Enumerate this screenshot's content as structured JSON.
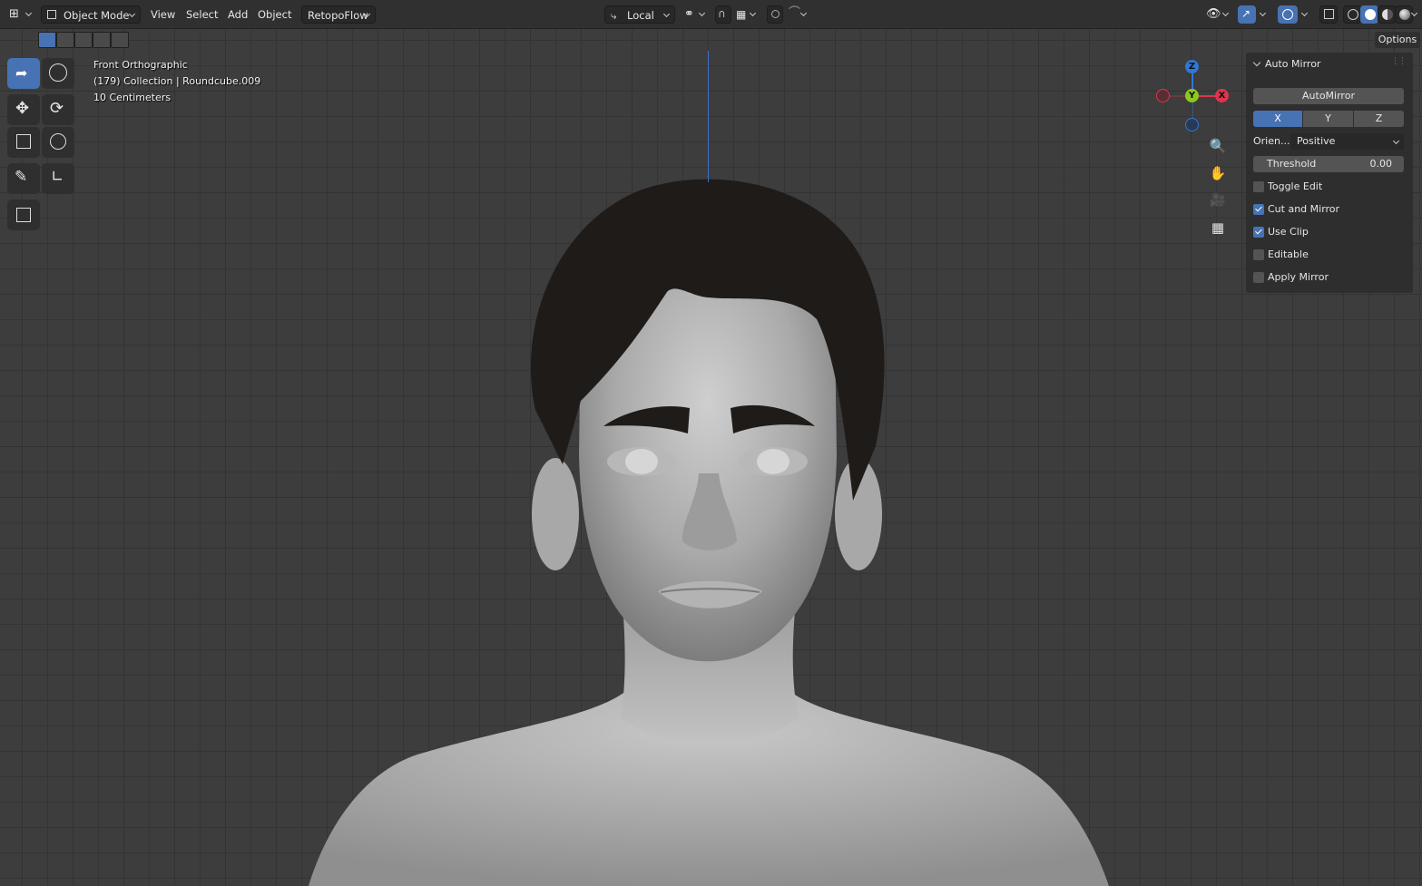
{
  "header": {
    "editor_type_icon": "editor-type-icon",
    "mode_label": "Object Mode",
    "menus": [
      "View",
      "Select",
      "Add",
      "Object"
    ],
    "addon_menu": "RetopoFlow",
    "transform_orientation": "Local"
  },
  "viewport": {
    "view_name": "Front Orthographic",
    "collection_info": "(179) Collection | Roundcube.009",
    "grid_scale": "10 Centimeters"
  },
  "gizmo": {
    "z_label": "Z",
    "y_label": "Y",
    "x_label": "X"
  },
  "sidebar": {
    "options_label": "Options",
    "panel_title": "Auto Mirror",
    "automirror_button": "AutoMirror",
    "axes": [
      "X",
      "Y",
      "Z"
    ],
    "active_axis": "X",
    "orientation_label": "Orien...",
    "orientation_value": "Positive",
    "threshold_label": "Threshold",
    "threshold_value": "0.00",
    "checkboxes": [
      {
        "label": "Toggle Edit",
        "checked": false
      },
      {
        "label": "Cut and Mirror",
        "checked": true
      },
      {
        "label": "Use Clip",
        "checked": true
      },
      {
        "label": "Editable",
        "checked": false
      },
      {
        "label": "Apply Mirror",
        "checked": false
      }
    ]
  },
  "colors": {
    "accent": "#4772b3",
    "x_axis": "#e0344d",
    "y_axis": "#8cc81e",
    "z_axis": "#2f78d4"
  }
}
